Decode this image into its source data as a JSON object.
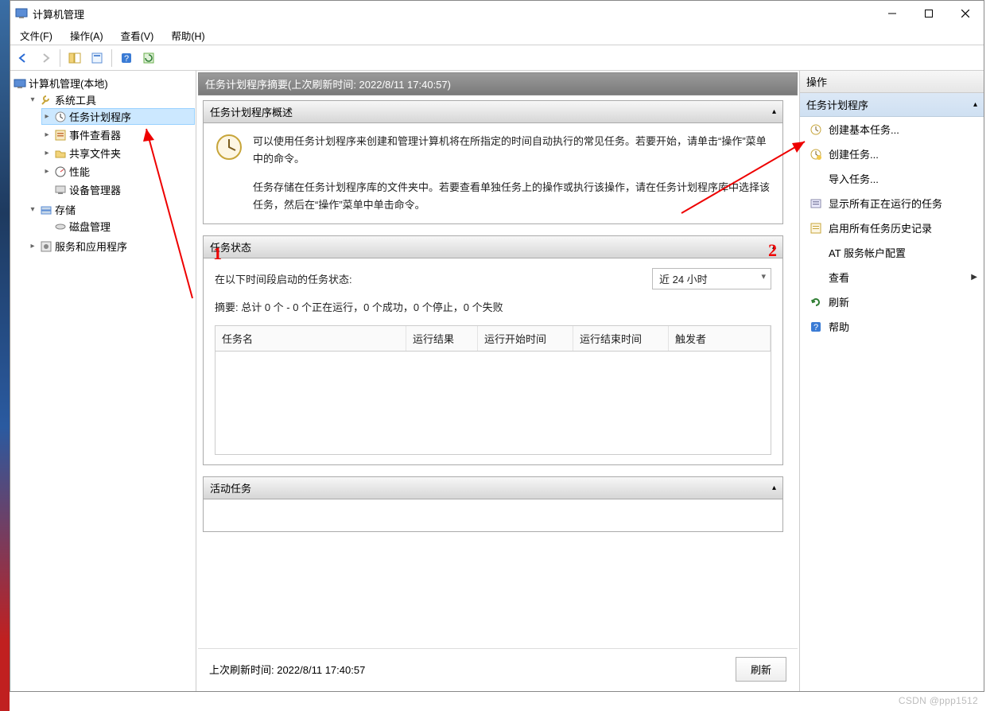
{
  "window": {
    "title": "计算机管理"
  },
  "menubar": {
    "file": "文件(F)",
    "action": "操作(A)",
    "view": "查看(V)",
    "help": "帮助(H)"
  },
  "tree": {
    "root": "计算机管理(本地)",
    "system_tools": "系统工具",
    "task_scheduler": "任务计划程序",
    "event_viewer": "事件查看器",
    "shared_folders": "共享文件夹",
    "performance": "性能",
    "device_manager": "设备管理器",
    "storage": "存储",
    "disk_mgmt": "磁盘管理",
    "services_apps": "服务和应用程序"
  },
  "summary": {
    "header": "任务计划程序摘要(上次刷新时间: 2022/8/11 17:40:57)",
    "overview_title": "任务计划程序概述",
    "overview_p1": "可以使用任务计划程序来创建和管理计算机将在所指定的时间自动执行的常见任务。若要开始，请单击“操作”菜单中的命令。",
    "overview_p2": "任务存储在任务计划程序库的文件夹中。若要查看单独任务上的操作或执行该操作，请在任务计划程序库中选择该任务，然后在“操作”菜单中单击命令。",
    "task_status_title": "任务状态",
    "task_status_label": "在以下时间段启动的任务状态:",
    "task_status_range": "近 24 小时",
    "task_status_summary": "摘要: 总计 0 个 - 0 个正在运行，0 个成功，0 个停止，0 个失败",
    "cols": {
      "name": "任务名",
      "result": "运行结果",
      "start": "运行开始时间",
      "end": "运行结束时间",
      "trigger": "触发者"
    },
    "active_tasks_title": "活动任务",
    "last_refresh": "上次刷新时间: 2022/8/11 17:40:57",
    "refresh_btn": "刷新"
  },
  "actions": {
    "pane_title": "操作",
    "group": "任务计划程序",
    "create_basic": "创建基本任务...",
    "create_task": "创建任务...",
    "import_task": "导入任务...",
    "show_running": "显示所有正在运行的任务",
    "enable_history": "启用所有任务历史记录",
    "at_account": "AT 服务帐户配置",
    "view": "查看",
    "refresh": "刷新",
    "help": "帮助"
  },
  "annotations": {
    "one": "1",
    "two": "2"
  },
  "watermark": "CSDN @ppp1512"
}
